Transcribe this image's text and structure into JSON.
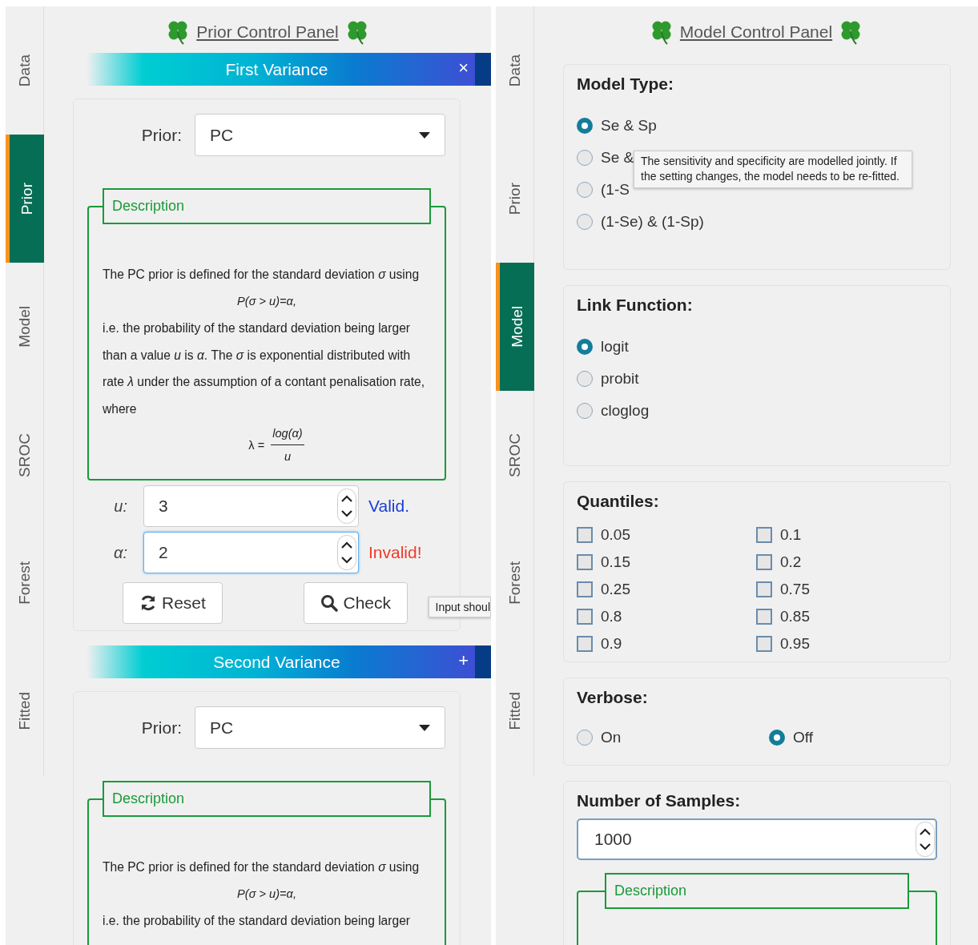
{
  "prior_panel": {
    "tabs": [
      {
        "label": "Data",
        "selected": false
      },
      {
        "label": "Prior",
        "selected": true
      },
      {
        "label": "Model",
        "selected": false
      },
      {
        "label": "SROC",
        "selected": false
      },
      {
        "label": "Forest",
        "selected": false
      },
      {
        "label": "Fitted",
        "selected": false
      }
    ],
    "title": "Prior Control Panel",
    "tooltip": "Input shoul",
    "variances": [
      {
        "title": "First Variance",
        "toggle": "×",
        "prior_label": "Prior:",
        "prior_value": "PC",
        "description_title": "Description",
        "description": [
          {
            "kind": "text",
            "text": "The PC prior is defined for the standard deviation *σ* using"
          },
          {
            "kind": "formula",
            "text": "P(σ > u)=α,"
          },
          {
            "kind": "text",
            "text": "i.e. the probability of the standard deviation being larger than a value *u* is *α*. The *σ* is exponential distributed with rate *λ* under the assumption of a contant penalisation rate, where"
          },
          {
            "kind": "fraction",
            "lhs": "λ =",
            "numerator": "log(α)",
            "denominator": "u"
          }
        ],
        "params": [
          {
            "label": "u:",
            "value": "3",
            "focused": false,
            "status": "Valid.",
            "valid": true
          },
          {
            "label": "α:",
            "value": "2",
            "focused": true,
            "status": "Invalid!",
            "valid": false
          }
        ],
        "buttons": [
          {
            "label": "Reset"
          },
          {
            "label": "Check"
          }
        ]
      },
      {
        "title": "Second Variance",
        "toggle": "+",
        "prior_label": "Prior:",
        "prior_value": "PC",
        "description_title": "Description",
        "description": [
          {
            "kind": "text",
            "text": "The PC prior is defined for the standard deviation *σ* using"
          },
          {
            "kind": "formula",
            "text": "P(σ > u)=α,"
          },
          {
            "kind": "text",
            "text": "i.e. the probability of the standard deviation being larger"
          }
        ]
      }
    ]
  },
  "model_panel": {
    "tabs": [
      {
        "label": "Data",
        "selected": false
      },
      {
        "label": "Prior",
        "selected": false
      },
      {
        "label": "Model",
        "selected": true
      },
      {
        "label": "SROC",
        "selected": false
      },
      {
        "label": "Forest",
        "selected": false
      },
      {
        "label": "Fitted",
        "selected": false
      }
    ],
    "title": "Model Control Panel",
    "groups": [
      {
        "kind": "radio",
        "title": "Model Type:",
        "tooltip": "The sensitivity and specificity are modelled jointly. If the setting changes, the model needs to be re-fitted.",
        "options": [
          {
            "label": "Se & Sp",
            "selected": true
          },
          {
            "label": "Se &",
            "selected": false
          },
          {
            "label": "(1-S",
            "selected": false
          },
          {
            "label": "(1-Se) & (1-Sp)",
            "selected": false
          }
        ]
      },
      {
        "kind": "radio",
        "title": "Link Function:",
        "options": [
          {
            "label": "logit",
            "selected": true
          },
          {
            "label": "probit",
            "selected": false
          },
          {
            "label": "cloglog",
            "selected": false
          }
        ]
      },
      {
        "kind": "checkbox_grid",
        "title": "Quantiles:",
        "options": [
          {
            "label": "0.05",
            "checked": false
          },
          {
            "label": "0.1",
            "checked": false
          },
          {
            "label": "0.15",
            "checked": false
          },
          {
            "label": "0.2",
            "checked": false
          },
          {
            "label": "0.25",
            "checked": false
          },
          {
            "label": "0.75",
            "checked": false
          },
          {
            "label": "0.8",
            "checked": false
          },
          {
            "label": "0.85",
            "checked": false
          },
          {
            "label": "0.9",
            "checked": false
          },
          {
            "label": "0.95",
            "checked": false
          }
        ]
      },
      {
        "kind": "radio_row",
        "title": "Verbose:",
        "options": [
          {
            "label": "On",
            "selected": false
          },
          {
            "label": "Off",
            "selected": true
          }
        ]
      },
      {
        "kind": "number",
        "title": "Number of Samples:",
        "value": "1000",
        "description_title": "Description"
      }
    ]
  }
}
